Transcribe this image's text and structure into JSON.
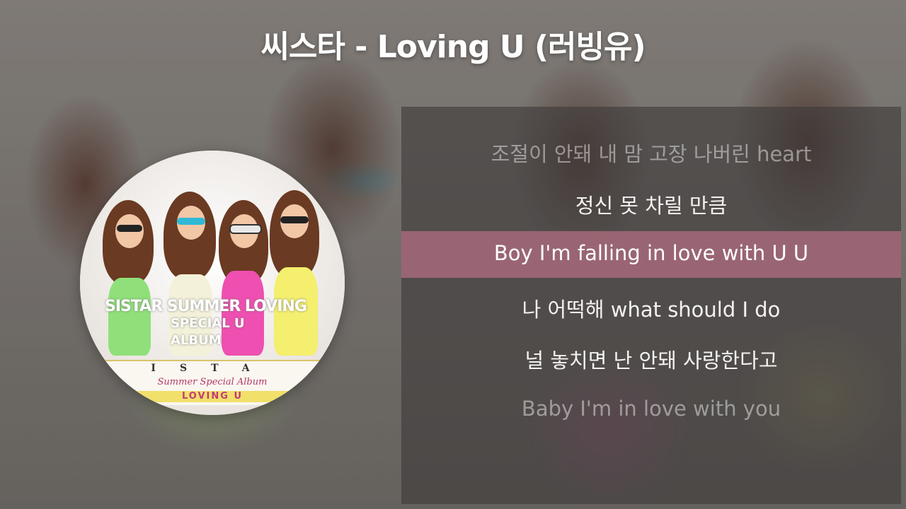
{
  "title": "씨스타 - Loving U (러빙유)",
  "album": {
    "cover_text_line1": "SISTAR SUMMER LOVING",
    "cover_text_line2": "SPECIAL U",
    "cover_text_line3": "ALBUM",
    "band_letters": "ISTA",
    "band_caption": "Summer Special Album",
    "band_title": "LOVING U"
  },
  "lyrics": {
    "lines": [
      "조절이 안돼 내 맘 고장 나버린 heart",
      "정신 못 차릴 만큼",
      "Boy I'm falling in love with U U",
      "나 어떡해 what should I do",
      "널 놓치면 난 안돼 사랑한다고",
      "Baby I'm in love with you"
    ],
    "active_index": 2
  },
  "colors": {
    "highlight": "#b26e82",
    "title": "#ffffff",
    "dim_text": "rgba(255,255,255,0.45)"
  }
}
